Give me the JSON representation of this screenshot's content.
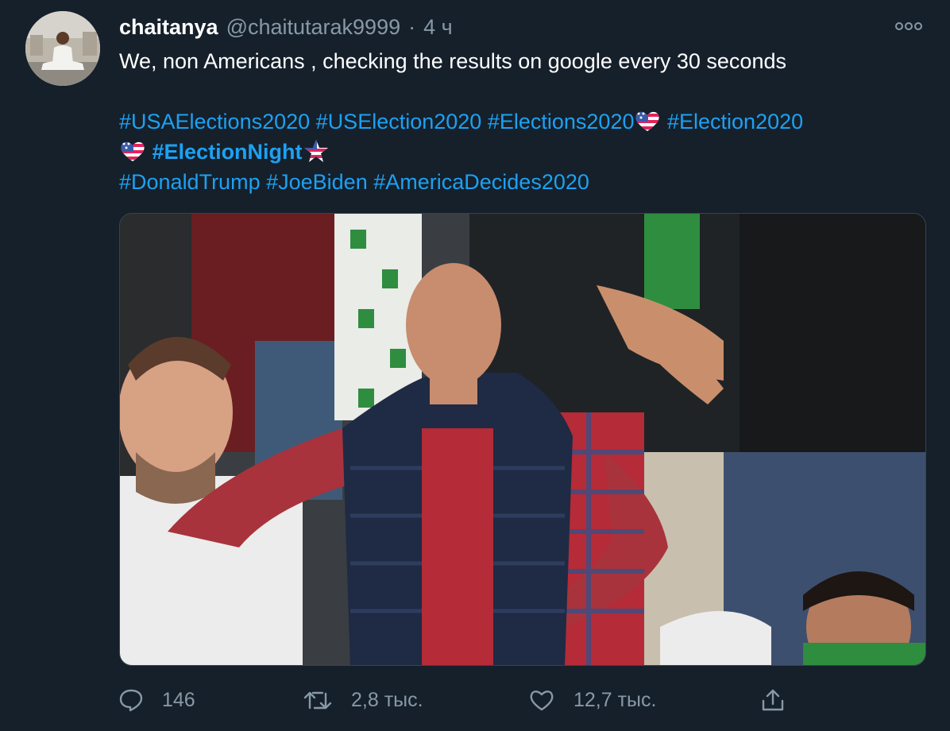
{
  "tweet": {
    "author_name": "chaitanya",
    "author_handle": "@chaitutarak9999",
    "separator": "·",
    "time": "4 ч",
    "text": "We, non Americans , checking the results on google every 30 seconds",
    "hashtags": {
      "usaelections2020": "#USAElections2020",
      "uselection2020": "#USElection2020",
      "elections2020": "#Elections2020",
      "election2020": "#Election2020",
      "electionnight": "#ElectionNight",
      "donaldtrump": "#DonaldTrump",
      "joebiden": "#JoeBiden",
      "americadecides2020": "#AmericaDecides2020"
    },
    "emojis": {
      "heart_flag": "us-flag-heart-icon",
      "star_flag": "us-flag-star-icon"
    },
    "media": {
      "icon": "meme-photo"
    },
    "stats": {
      "replies": "146",
      "retweets": "2,8 тыс.",
      "likes": "12,7 тыс."
    }
  },
  "colors": {
    "background": "#15202b",
    "primary_text": "#ffffff",
    "secondary_text": "#8899a6",
    "link": "#1da1f2"
  }
}
